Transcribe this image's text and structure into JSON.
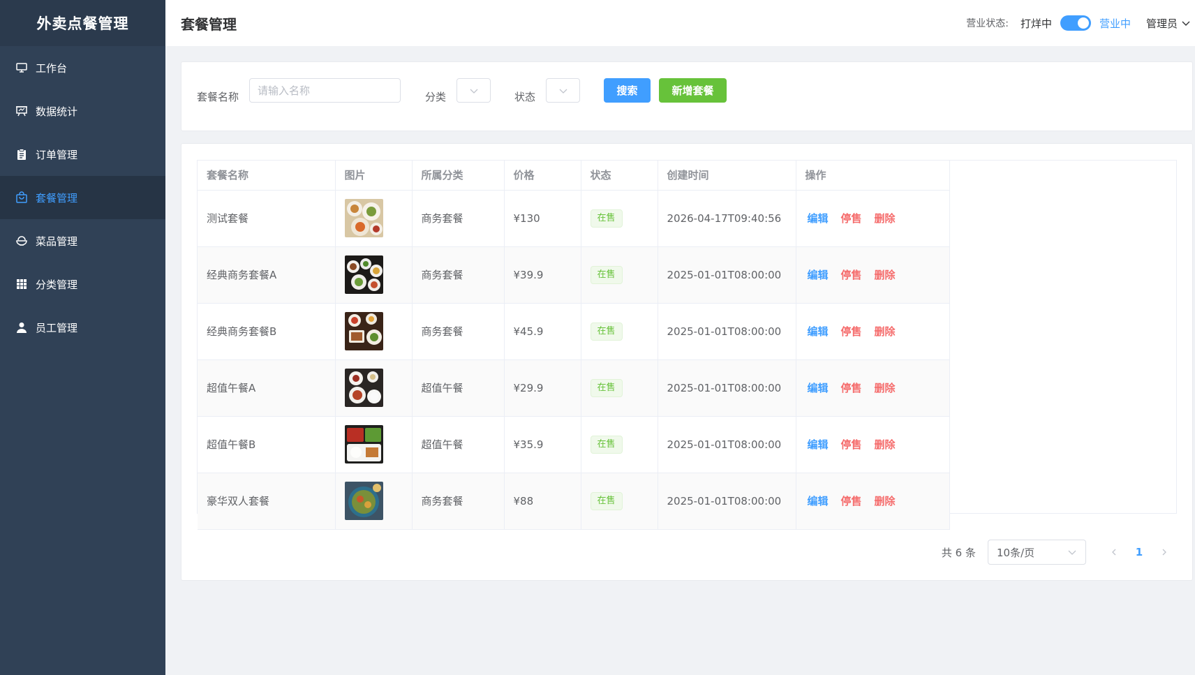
{
  "app": {
    "title": "外卖点餐管理"
  },
  "sidebar": {
    "items": [
      {
        "label": "工作台",
        "icon": "monitor-icon",
        "active": false
      },
      {
        "label": "数据统计",
        "icon": "presentation-icon",
        "active": false
      },
      {
        "label": "订单管理",
        "icon": "clipboard-icon",
        "active": false
      },
      {
        "label": "套餐管理",
        "icon": "shopping-bag-icon",
        "active": true
      },
      {
        "label": "菜品管理",
        "icon": "food-bowl-icon",
        "active": false
      },
      {
        "label": "分类管理",
        "icon": "grid-icon",
        "active": false
      },
      {
        "label": "员工管理",
        "icon": "user-icon",
        "active": false
      }
    ]
  },
  "header": {
    "title": "套餐管理",
    "biz_status_label": "营业状态:",
    "biz_off_label": "打烊中",
    "biz_on_label": "营业中",
    "biz_open": true,
    "admin_label": "管理员"
  },
  "search": {
    "name_label": "套餐名称",
    "name_placeholder": "请输入名称",
    "name_value": "",
    "category_label": "分类",
    "category_value": "",
    "status_label": "状态",
    "status_value": "",
    "search_button": "搜索",
    "add_button": "新增套餐"
  },
  "table": {
    "columns": [
      "套餐名称",
      "图片",
      "所属分类",
      "价格",
      "状态",
      "创建时间",
      "操作"
    ],
    "rows": [
      {
        "name": "测试套餐",
        "category": "商务套餐",
        "price": "¥130",
        "status": "在售",
        "created": "2026-04-17T09:40:56",
        "thumb": "photo-food-1"
      },
      {
        "name": "经典商务套餐A",
        "category": "商务套餐",
        "price": "¥39.9",
        "status": "在售",
        "created": "2025-01-01T08:00:00",
        "thumb": "photo-food-2"
      },
      {
        "name": "经典商务套餐B",
        "category": "商务套餐",
        "price": "¥45.9",
        "status": "在售",
        "created": "2025-01-01T08:00:00",
        "thumb": "photo-food-3"
      },
      {
        "name": "超值午餐A",
        "category": "超值午餐",
        "price": "¥29.9",
        "status": "在售",
        "created": "2025-01-01T08:00:00",
        "thumb": "photo-food-4"
      },
      {
        "name": "超值午餐B",
        "category": "超值午餐",
        "price": "¥35.9",
        "status": "在售",
        "created": "2025-01-01T08:00:00",
        "thumb": "photo-food-5"
      },
      {
        "name": "豪华双人套餐",
        "category": "商务套餐",
        "price": "¥88",
        "status": "在售",
        "created": "2025-01-01T08:00:00",
        "thumb": "photo-food-6"
      }
    ],
    "actions": {
      "edit": "编辑",
      "stop": "停售",
      "delete": "删除"
    }
  },
  "pagination": {
    "total_label": "共 6 条",
    "page_size_label": "10条/页",
    "current_page": "1"
  },
  "colors": {
    "sidebar_bg": "#304156",
    "accent": "#409eff",
    "success": "#67c23a",
    "danger": "#f56c6c"
  }
}
